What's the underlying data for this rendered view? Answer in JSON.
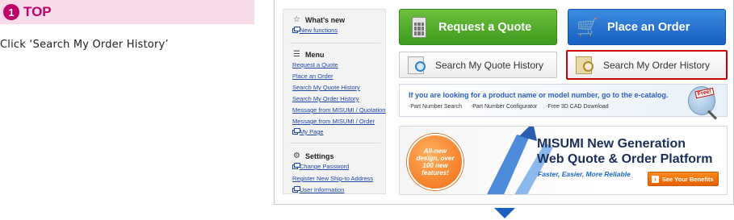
{
  "step": {
    "number": "1",
    "title": "TOP",
    "instruction": "Click ‘Search My Order History’"
  },
  "sidebar": {
    "whats_new": {
      "heading": "What's new",
      "icon": "star-icon",
      "links": [
        "New functions"
      ]
    },
    "menu": {
      "heading": "Menu",
      "icon": "list-icon",
      "links": [
        "Request a Quote",
        "Place an Order",
        "Search My Quote History",
        "Search My Order History",
        "Message from MISUMI / Quotation",
        "Message from MISUMI / Order",
        "My Page"
      ]
    },
    "settings": {
      "heading": "Settings",
      "icon": "gear-icon",
      "links": [
        "Change Password",
        "Register New Ship-to Address",
        "User Information"
      ]
    }
  },
  "buttons": {
    "request_quote": "Request a Quote",
    "place_order": "Place an Order",
    "search_quote_history": "Search My Quote History",
    "search_order_history": "Search My Order History"
  },
  "catalog_banner": {
    "headline": "If you are looking for a product name or model number, go to the e-catalog.",
    "features": [
      "‧Part Number Search",
      "‧Part Number Configurator",
      "‧Free 3D CAD Download"
    ],
    "badge": "Free!"
  },
  "platform_banner": {
    "badge": "All-new design, over 100 new features!",
    "title_line1": "MISUMI New Generation",
    "title_line2": "Web Quote & Order Platform",
    "tagline": "Faster, Easier, More Reliable",
    "cta": "See Your Benefits"
  },
  "colors": {
    "step_accent": "#c0006a",
    "highlight": "#cc0000",
    "green_button": "#3c9a1c",
    "blue_button": "#1560c0",
    "orange_cta": "#e65f00"
  }
}
